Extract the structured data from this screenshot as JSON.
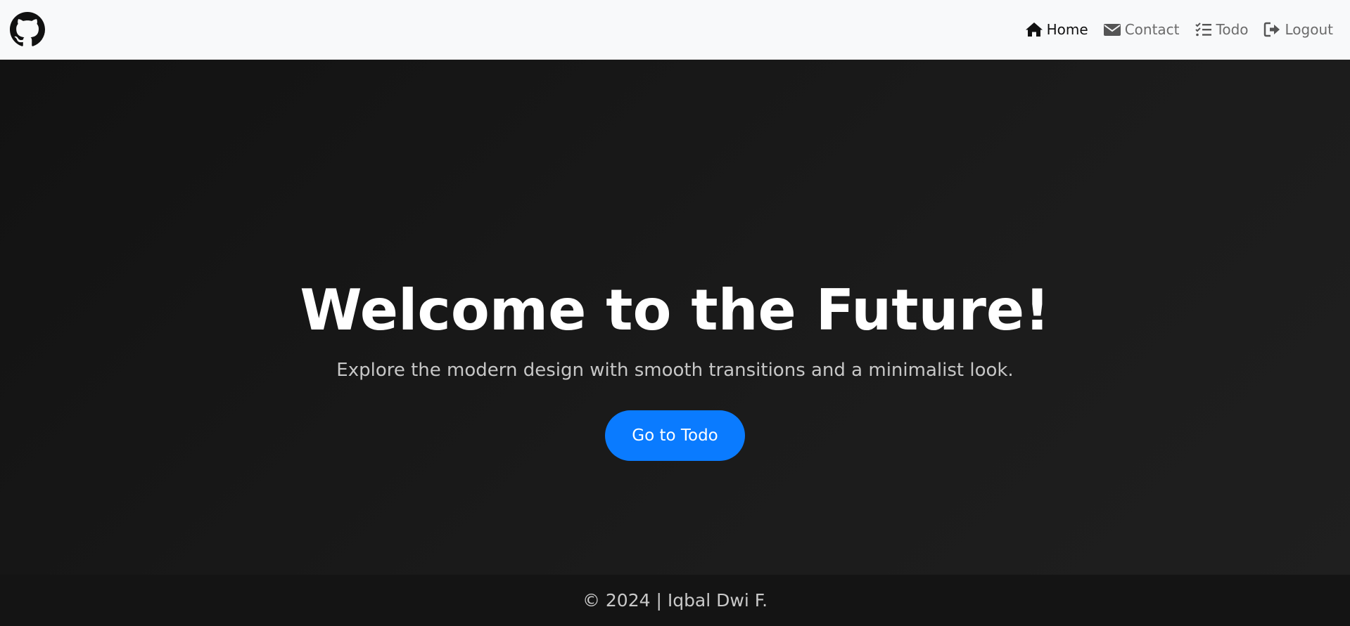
{
  "navbar": {
    "brand_icon": "github-icon",
    "links": [
      {
        "label": "Home",
        "icon": "home-icon",
        "active": true
      },
      {
        "label": "Contact",
        "icon": "envelope-icon",
        "active": false
      },
      {
        "label": "Todo",
        "icon": "list-check-icon",
        "active": false
      },
      {
        "label": "Logout",
        "icon": "logout-icon",
        "active": false
      }
    ]
  },
  "hero": {
    "title": "Welcome to the Future!",
    "subtitle": "Explore the modern design with smooth transitions and a minimalist look.",
    "cta_label": "Go to Todo"
  },
  "footer": {
    "text": "© 2024 | Iqbal Dwi F."
  },
  "colors": {
    "accent": "#0a7bff",
    "hero_bg": "#181818",
    "navbar_bg": "#f8f9fa",
    "footer_bg": "#141414"
  }
}
